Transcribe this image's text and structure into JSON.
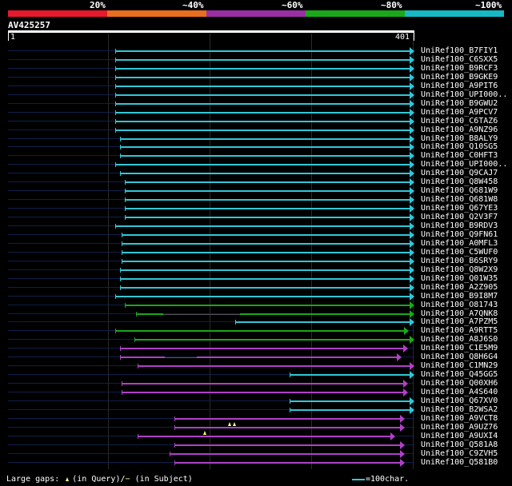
{
  "scale": {
    "labels": [
      "20%",
      "~40%",
      "~60%",
      "~80%",
      "~100%"
    ],
    "colors": [
      "#e8192c",
      "#e86e1e",
      "#9c2ea3",
      "#1aa81a",
      "#16b8c4"
    ]
  },
  "query": {
    "title": "AV425257",
    "start": "1",
    "end": "401"
  },
  "hits": [
    {
      "name": "UniRef100_B7FIY1",
      "color": "#2fc8d8",
      "s": 144,
      "e": 512
    },
    {
      "name": "UniRef100_C6SXX5",
      "color": "#2fc8d8",
      "s": 144,
      "e": 512
    },
    {
      "name": "UniRef100_B9RCF3",
      "color": "#2fc8d8",
      "s": 144,
      "e": 512
    },
    {
      "name": "UniRef100_B9GKE9",
      "color": "#2fc8d8",
      "s": 144,
      "e": 512
    },
    {
      "name": "UniRef100_A9PIT6",
      "color": "#2fc8d8",
      "s": 144,
      "e": 512
    },
    {
      "name": "UniRef100_UPI000..",
      "color": "#2fc8d8",
      "s": 144,
      "e": 512
    },
    {
      "name": "UniRef100_B9GWU2",
      "color": "#2fc8d8",
      "s": 144,
      "e": 512
    },
    {
      "name": "UniRef100_A9PCV7",
      "color": "#2fc8d8",
      "s": 144,
      "e": 512
    },
    {
      "name": "UniRef100_C6TAZ6",
      "color": "#2fc8d8",
      "s": 144,
      "e": 512
    },
    {
      "name": "UniRef100_A9NZ96",
      "color": "#2fc8d8",
      "s": 144,
      "e": 512
    },
    {
      "name": "UniRef100_B8ALY9",
      "color": "#2fc8d8",
      "s": 150,
      "e": 512
    },
    {
      "name": "UniRef100_Q10SG5",
      "color": "#2fc8d8",
      "s": 150,
      "e": 512
    },
    {
      "name": "UniRef100_C0HFT3",
      "color": "#2fc8d8",
      "s": 150,
      "e": 512
    },
    {
      "name": "UniRef100_UPI000..",
      "color": "#2fc8d8",
      "s": 144,
      "e": 512
    },
    {
      "name": "UniRef100_Q9CAJ7",
      "color": "#2fc8d8",
      "s": 150,
      "e": 512
    },
    {
      "name": "UniRef100_Q8W458",
      "color": "#2fc8d8",
      "s": 156,
      "e": 512
    },
    {
      "name": "UniRef100_Q681W9",
      "color": "#2fc8d8",
      "s": 156,
      "e": 512
    },
    {
      "name": "UniRef100_Q681W8",
      "color": "#2fc8d8",
      "s": 156,
      "e": 512
    },
    {
      "name": "UniRef100_Q67YE3",
      "color": "#2fc8d8",
      "s": 156,
      "e": 512
    },
    {
      "name": "UniRef100_Q2V3F7",
      "color": "#2fc8d8",
      "s": 156,
      "e": 512
    },
    {
      "name": "UniRef100_B9RDV3",
      "color": "#2fc8d8",
      "s": 144,
      "e": 512
    },
    {
      "name": "UniRef100_Q9FN61",
      "color": "#2fc8d8",
      "s": 152,
      "e": 512
    },
    {
      "name": "UniRef100_A0MFL3",
      "color": "#2fc8d8",
      "s": 152,
      "e": 512
    },
    {
      "name": "UniRef100_C5WUF0",
      "color": "#2fc8d8",
      "s": 152,
      "e": 512
    },
    {
      "name": "UniRef100_B6SRY9",
      "color": "#2fc8d8",
      "s": 152,
      "e": 512
    },
    {
      "name": "UniRef100_Q8W2X9",
      "color": "#2fc8d8",
      "s": 150,
      "e": 512
    },
    {
      "name": "UniRef100_Q01W35",
      "color": "#2fc8d8",
      "s": 150,
      "e": 512
    },
    {
      "name": "UniRef100_A2Z905",
      "color": "#2fc8d8",
      "s": 150,
      "e": 512
    },
    {
      "name": "UniRef100_B9I8M7",
      "color": "#2fc8d8",
      "s": 144,
      "e": 512
    },
    {
      "name": "UniRef100_O81743",
      "color": "#1aa81a",
      "s": 156,
      "e": 512
    },
    {
      "name": "UniRef100_A7QNK8",
      "color": "#1aa81a",
      "s": 170,
      "e": 512,
      "split": [
        204,
        300
      ]
    },
    {
      "name": "UniRef100_A7PZM5",
      "color": "#2fc8d8",
      "s": 294,
      "e": 512
    },
    {
      "name": "UniRef100_A9RTT5",
      "color": "#1aa81a",
      "s": 144,
      "e": 505
    },
    {
      "name": "UniRef100_A8J6S0",
      "color": "#1aa81a",
      "s": 168,
      "e": 512
    },
    {
      "name": "UniRef100_C1E5M9",
      "color": "#b040c8",
      "s": 150,
      "e": 504
    },
    {
      "name": "UniRef100_Q8H6G4",
      "color": "#b040c8",
      "s": 150,
      "e": 496,
      "split": [
        206,
        246
      ]
    },
    {
      "name": "UniRef100_C1MN29",
      "color": "#b040c8",
      "s": 172,
      "e": 512
    },
    {
      "name": "UniRef100_Q45GG5",
      "color": "#2fc8d8",
      "s": 362,
      "e": 512
    },
    {
      "name": "UniRef100_Q00XH6",
      "color": "#b040c8",
      "s": 152,
      "e": 504
    },
    {
      "name": "UniRef100_A4S640",
      "color": "#b040c8",
      "s": 152,
      "e": 504
    },
    {
      "name": "UniRef100_Q67XV0",
      "color": "#2fc8d8",
      "s": 362,
      "e": 512
    },
    {
      "name": "UniRef100_B2WSA2",
      "color": "#2fc8d8",
      "s": 362,
      "e": 512
    },
    {
      "name": "UniRef100_A9VCT8",
      "color": "#b040c8",
      "s": 218,
      "e": 500
    },
    {
      "name": "UniRef100_A9UZ76",
      "color": "#b040c8",
      "s": 218,
      "e": 500,
      "marks": [
        287,
        293
      ]
    },
    {
      "name": "UniRef100_A9UXI4",
      "color": "#b040c8",
      "s": 172,
      "e": 488,
      "marks": [
        256
      ]
    },
    {
      "name": "UniRef100_Q581A8",
      "color": "#b040c8",
      "s": 218,
      "e": 500
    },
    {
      "name": "UniRef100_C9ZVH5",
      "color": "#b040c8",
      "s": 212,
      "e": 500
    },
    {
      "name": "UniRef100_Q581B0",
      "color": "#b040c8",
      "s": 218,
      "e": 500
    }
  ],
  "footer": {
    "gaps_prefix": "Large gaps:",
    "gaps_query": "(in Query)/",
    "gaps_subject": "(in Subject)",
    "legend": "=100char."
  }
}
